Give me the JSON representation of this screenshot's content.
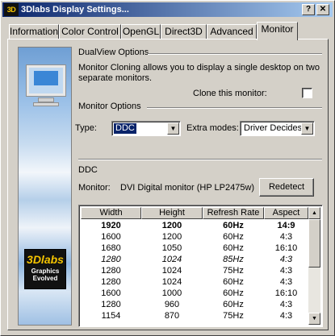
{
  "window": {
    "title": "3Dlabs Display Settings...",
    "icon_text": "3D",
    "help_button": "?",
    "close_button": "✕"
  },
  "tabs": [
    {
      "label": "Information",
      "active": false
    },
    {
      "label": "Color Control",
      "active": false
    },
    {
      "label": "OpenGL",
      "active": false
    },
    {
      "label": "Direct3D",
      "active": false
    },
    {
      "label": "Advanced",
      "active": false
    },
    {
      "label": "Monitor",
      "active": true
    }
  ],
  "sidebar": {
    "image": "monitor-and-clouds",
    "logo_text": "3Dlabs",
    "logo_tagline": "Graphics Evolved"
  },
  "dualview": {
    "heading": "DualView Options",
    "description": "Monitor Cloning allows you to display a single desktop on two separate monitors.",
    "clone_label": "Clone this monitor:",
    "clone_checked": false
  },
  "monitor_options": {
    "heading": "Monitor Options",
    "type_label": "Type:",
    "type_value": "DDC",
    "extra_modes_label": "Extra modes:",
    "extra_modes_value": "Driver Decides"
  },
  "ddc": {
    "heading": "DDC",
    "monitor_label": "Monitor:",
    "monitor_value": "DVI Digital monitor (HP LP2475w)",
    "redetect_label": "Redetect"
  },
  "modes_table": {
    "columns": [
      "Width",
      "Height",
      "Refresh Rate",
      "Aspect"
    ],
    "rows": [
      {
        "cells": [
          "1920",
          "1200",
          "60Hz",
          "14:9"
        ],
        "style": "bold"
      },
      {
        "cells": [
          "1600",
          "1200",
          "60Hz",
          "4:3"
        ],
        "style": "normal"
      },
      {
        "cells": [
          "1680",
          "1050",
          "60Hz",
          "16:10"
        ],
        "style": "normal"
      },
      {
        "cells": [
          "1280",
          "1024",
          "85Hz",
          "4:3"
        ],
        "style": "italic"
      },
      {
        "cells": [
          "1280",
          "1024",
          "75Hz",
          "4:3"
        ],
        "style": "normal"
      },
      {
        "cells": [
          "1280",
          "1024",
          "60Hz",
          "4:3"
        ],
        "style": "normal"
      },
      {
        "cells": [
          "1600",
          "1000",
          "60Hz",
          "16:10"
        ],
        "style": "normal"
      },
      {
        "cells": [
          "1280",
          "960",
          "60Hz",
          "4:3"
        ],
        "style": "normal"
      },
      {
        "cells": [
          "1154",
          "870",
          "75Hz",
          "4:3"
        ],
        "style": "normal"
      }
    ]
  },
  "scrollbar": {
    "up_icon": "▲",
    "down_icon": "▼"
  },
  "colors": {
    "title_bar_start": "#0a246a",
    "title_bar_end": "#a6caf0",
    "face": "#d4d0c8",
    "selection": "#0a246a",
    "logo_accent": "#f5c400"
  }
}
